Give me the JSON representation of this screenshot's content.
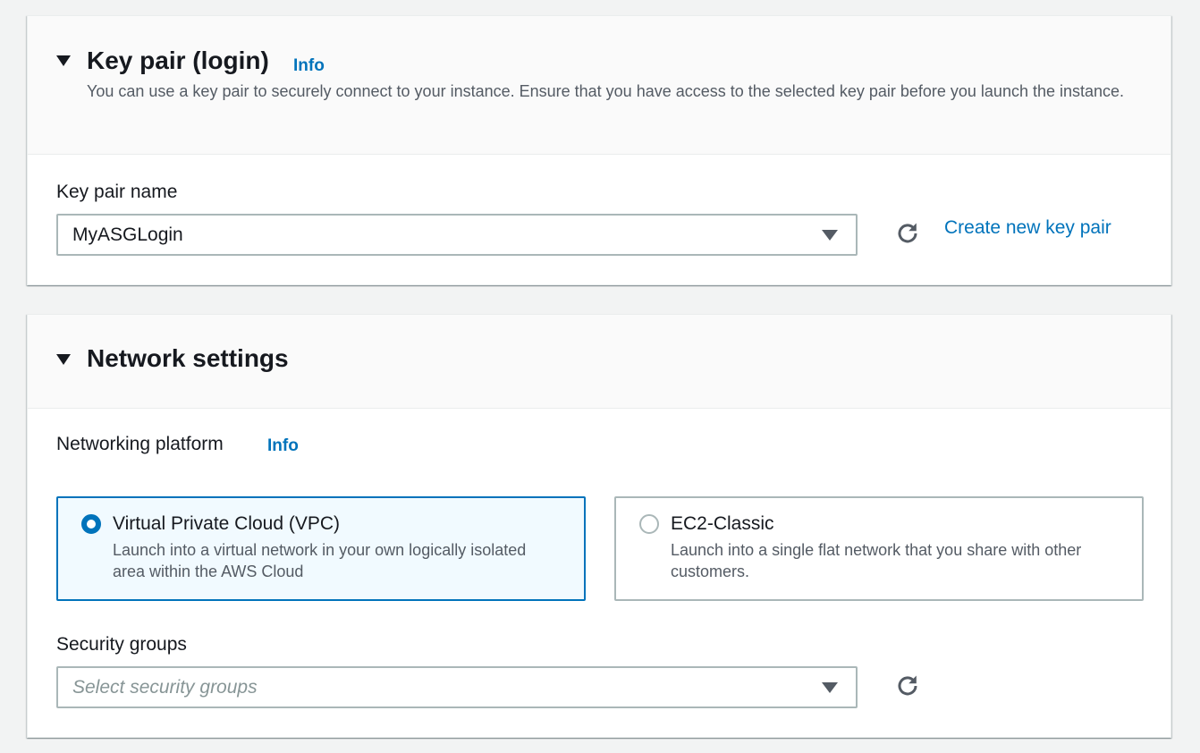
{
  "key_pair_panel": {
    "title": "Key pair (login)",
    "info_label": "Info",
    "description": "You can use a key pair to securely connect to your instance. Ensure that you have access to the selected key pair before you launch the instance.",
    "field_label": "Key pair name",
    "selected_value": "MyASGLogin",
    "create_link": "Create new key pair"
  },
  "network_panel": {
    "title": "Network settings",
    "platform_label": "Networking platform",
    "platform_info_label": "Info",
    "options": [
      {
        "title": "Virtual Private Cloud (VPC)",
        "description": "Launch into a virtual network in your own logically isolated area within the AWS Cloud",
        "selected": true
      },
      {
        "title": "EC2-Classic",
        "description": "Launch into a single flat network that you share with other customers.",
        "selected": false
      }
    ],
    "security_groups_label": "Security groups",
    "security_groups_placeholder": "Select security groups"
  },
  "colors": {
    "link": "#0073bb",
    "selected_tile_bg": "#f1faff",
    "page_bg": "#f2f3f3"
  },
  "icons": [
    "caret-down-icon",
    "refresh-icon"
  ]
}
